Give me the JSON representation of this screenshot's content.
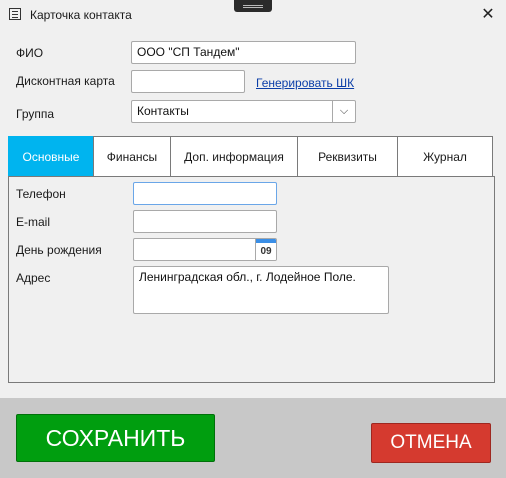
{
  "window": {
    "title": "Карточка контакта",
    "app_icon": "contact-card-icon",
    "close_glyph": "✕"
  },
  "form": {
    "fio_label": "ФИО",
    "fio_value": "ООО \"СП Тандем\"",
    "card_label": "Дисконтная карта",
    "card_value": "",
    "generate_link": "Генерировать ШК",
    "group_label": "Группа",
    "group_value": "Контакты",
    "group_arrow": "⌵"
  },
  "tabs": [
    {
      "label": "Основные",
      "active": true
    },
    {
      "label": "Финансы"
    },
    {
      "label": "Доп. информация"
    },
    {
      "label": "Реквизиты"
    },
    {
      "label": "Журнал"
    }
  ],
  "main": {
    "phone_label": "Телефон",
    "phone_value": "",
    "email_label": "E-mail",
    "email_value": "",
    "birthday_label": "День рождения",
    "birthday_value": "",
    "calendar_day": "09",
    "address_label": "Адрес",
    "address_value": "Ленинградская обл., г. Лодейное Поле."
  },
  "buttons": {
    "save": "СОХРАНИТЬ",
    "cancel": "ОТМЕНА"
  },
  "colors": {
    "active_tab": "#00b4ef",
    "save": "#009e0f",
    "cancel": "#d53a2f",
    "link": "#0b3ea8"
  }
}
